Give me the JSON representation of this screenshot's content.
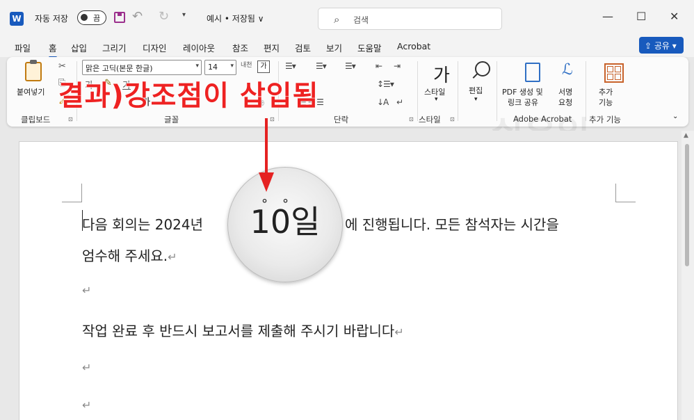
{
  "app": {
    "logo_letter": "W",
    "autosave_label": "자동 저장",
    "autosave_state": "끔",
    "doc_title": "예시 • 저장됨 ∨",
    "search_placeholder": "검색"
  },
  "window_controls": [
    "—",
    "☐",
    "✕"
  ],
  "tabs": [
    {
      "label": "파일"
    },
    {
      "label": "홈",
      "active": true
    },
    {
      "label": "삽입"
    },
    {
      "label": "그리기"
    },
    {
      "label": "디자인"
    },
    {
      "label": "레이아웃"
    },
    {
      "label": "참조"
    },
    {
      "label": "편지"
    },
    {
      "label": "검토"
    },
    {
      "label": "보기"
    },
    {
      "label": "도움말"
    },
    {
      "label": "Acrobat"
    }
  ],
  "share_label": "공유",
  "ribbon": {
    "paste_label": "붙여넣기",
    "font_name": "맑은 고딕(본문 한글)",
    "font_size": "14",
    "char_box": "가",
    "style_glyph": "가",
    "style_label": "스타일",
    "edit_label": "편집",
    "pdf_label_1": "PDF 생성 및",
    "pdf_label_2": "링크 공유",
    "sign_label_1": "서명",
    "sign_label_2": "요청",
    "addin_label_1": "추가",
    "addin_label_2": "기능",
    "groups": {
      "clipboard": "클립보드",
      "font": "글꼴",
      "paragraph": "단락",
      "styles": "스타일",
      "adobe": "Adobe Acrobat",
      "addins": "추가 기능"
    }
  },
  "document": {
    "line1_a": "다음 회의는 2024년",
    "line1_b": "에 진행됩니다. 모든 참석자는 시간을",
    "line2": "엄수해 주세요.",
    "line4": "작업 완료 후 반드시 보고서를 제출해 주시기 바랍니다",
    "para_mark": "↵"
  },
  "annotation": {
    "caption": "결과)강조점이 삽입됨",
    "magnified": "10일",
    "watermark": "쉬운일"
  },
  "colors": {
    "accent": "#185abd",
    "annotation_red": "#ee2222"
  }
}
